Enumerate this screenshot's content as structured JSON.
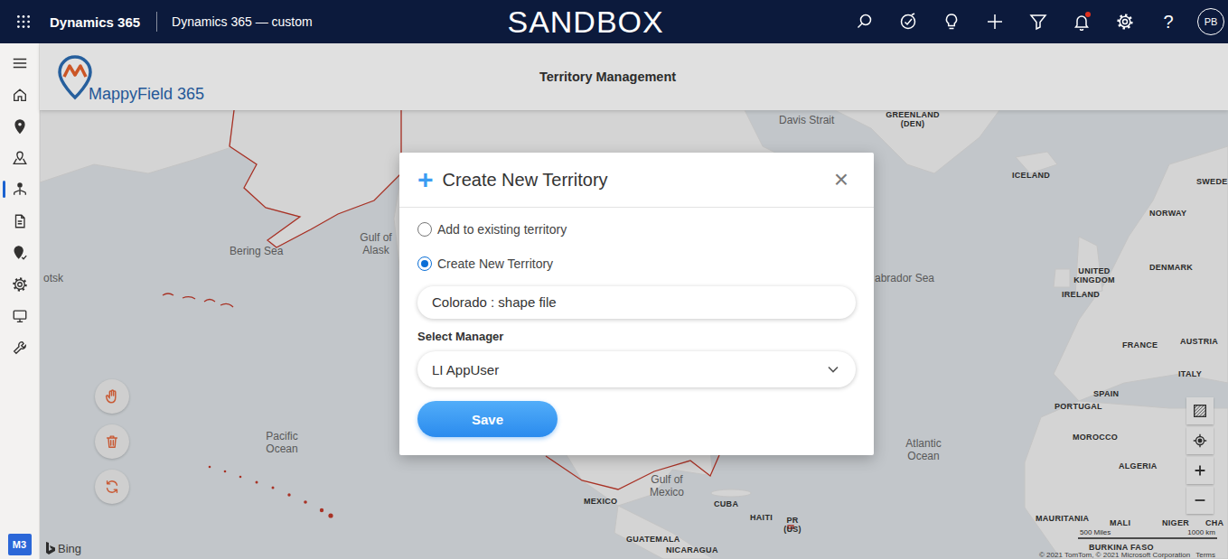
{
  "topbar": {
    "app": "Dynamics 365",
    "area": "Dynamics 365 — custom",
    "environment": "SANDBOX",
    "help": "?",
    "avatar": "PB",
    "actions": [
      {
        "kind": "search",
        "badge": false
      },
      {
        "kind": "task",
        "badge": false
      },
      {
        "kind": "idea",
        "badge": false
      },
      {
        "kind": "new",
        "badge": false
      },
      {
        "kind": "filter",
        "badge": false
      },
      {
        "kind": "notifications",
        "badge": true
      },
      {
        "kind": "settings",
        "badge": false
      }
    ]
  },
  "sidebar": {
    "items": [
      {
        "kind": "menu",
        "selected": false
      },
      {
        "kind": "home",
        "selected": false
      },
      {
        "kind": "pin",
        "selected": false
      },
      {
        "kind": "route",
        "selected": false
      },
      {
        "kind": "territory",
        "selected": true
      },
      {
        "kind": "report",
        "selected": false
      },
      {
        "kind": "checkin",
        "selected": false
      },
      {
        "kind": "settings",
        "selected": false
      },
      {
        "kind": "monitor",
        "selected": false
      },
      {
        "kind": "tools",
        "selected": false
      }
    ],
    "badge": "M3"
  },
  "header": {
    "logo": "MappyField 365",
    "title": "Territory Management"
  },
  "map": {
    "labels": [
      {
        "text": "Davis Strait",
        "kind": "sea"
      },
      {
        "text": "GREENLAND (DEN)",
        "kind": "country"
      },
      {
        "text": "ICELAND",
        "kind": "country"
      },
      {
        "text": "SWEDE",
        "kind": "country"
      },
      {
        "text": "NORWAY",
        "kind": "country"
      },
      {
        "text": "abrador Sea",
        "kind": "sea"
      },
      {
        "text": "DENMARK",
        "kind": "country"
      },
      {
        "text": "UNITED KINGDOM",
        "kind": "country"
      },
      {
        "text": "IRELAND",
        "kind": "country"
      },
      {
        "text": "FRANCE",
        "kind": "country"
      },
      {
        "text": "AUSTRIA",
        "kind": "country"
      },
      {
        "text": "ITALY",
        "kind": "country"
      },
      {
        "text": "SPAIN",
        "kind": "country"
      },
      {
        "text": "PORTUGAL",
        "kind": "country"
      },
      {
        "text": "MOROCCO",
        "kind": "country"
      },
      {
        "text": "ALGERIA",
        "kind": "country"
      },
      {
        "text": "Atlantic Ocean",
        "kind": "sea"
      },
      {
        "text": "MAURITANIA",
        "kind": "country"
      },
      {
        "text": "MALI",
        "kind": "country"
      },
      {
        "text": "NIGER",
        "kind": "country"
      },
      {
        "text": "CHA",
        "kind": "country"
      },
      {
        "text": "BURKINA FASO",
        "kind": "country"
      },
      {
        "text": "Bering Sea",
        "kind": "sea"
      },
      {
        "text": "Gulf of Alask",
        "kind": "sea"
      },
      {
        "text": "otsk",
        "kind": "sea"
      },
      {
        "text": "Pacific Ocean",
        "kind": "sea"
      },
      {
        "text": "MEXICO",
        "kind": "country"
      },
      {
        "text": "Gulf of Mexico",
        "kind": "sea"
      },
      {
        "text": "CUBA",
        "kind": "country"
      },
      {
        "text": "HAITI",
        "kind": "country"
      },
      {
        "text": "PR (US)",
        "kind": "country"
      },
      {
        "text": "GUATEMALA",
        "kind": "country"
      },
      {
        "text": "NICARAGUA",
        "kind": "country"
      }
    ],
    "tools": [
      {
        "kind": "pan"
      },
      {
        "kind": "delete"
      },
      {
        "kind": "refresh"
      }
    ],
    "controls": [
      {
        "kind": "draw"
      },
      {
        "kind": "locate"
      },
      {
        "kind": "zoomin"
      },
      {
        "kind": "zoomout"
      }
    ],
    "attribution": "Bing",
    "scale": [
      "500 Miles",
      "1000 km"
    ],
    "copyright": "© 2021 TomTom, © 2021 Microsoft Corporation",
    "terms": "Terms"
  },
  "dialog": {
    "icon": "+",
    "title": "Create New Territory",
    "close": "×",
    "options": [
      {
        "label": "Add to existing territory",
        "selected": false
      },
      {
        "label": "Create New Territory",
        "selected": true
      }
    ],
    "name": "Colorado : shape file",
    "manager_label": "Select Manager",
    "manager": "LI AppUser",
    "save": "Save"
  }
}
